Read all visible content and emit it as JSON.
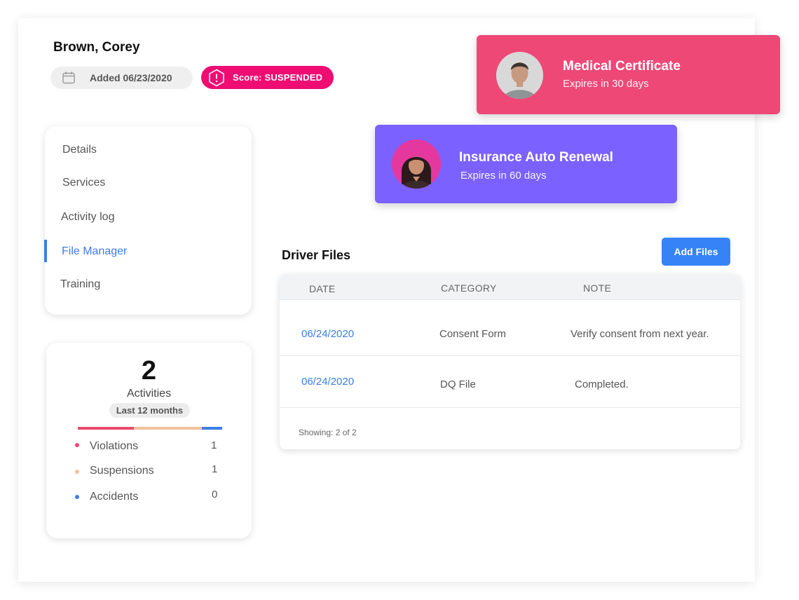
{
  "driver": {
    "name": "Brown, Corey",
    "added": "Added 06/23/2020",
    "score": "Score: SUSPENDED"
  },
  "nav": {
    "items": [
      {
        "label": "Details"
      },
      {
        "label": "Services"
      },
      {
        "label": "Activity log"
      },
      {
        "label": "File Manager"
      },
      {
        "label": "Training"
      }
    ],
    "active": "File Manager"
  },
  "activities": {
    "count": "2",
    "label": "Activities",
    "period": "Last 12 months",
    "rows": [
      {
        "label": "Violations",
        "value": "1",
        "color": "#e94a6f"
      },
      {
        "label": "Suspensions",
        "value": "1",
        "color": "#f1c39c"
      },
      {
        "label": "Accidents",
        "value": "0",
        "color": "#3b7de8"
      }
    ]
  },
  "alerts": [
    {
      "title": "Medical Certificate",
      "subtitle": "Expires in 30 days",
      "color": "#ee4877"
    },
    {
      "title": "Insurance Auto Renewal",
      "subtitle": "Expires in 60 days",
      "color": "#7b61ff"
    }
  ],
  "files": {
    "title": "Driver Files",
    "add_label": "Add Files",
    "columns": [
      "DATE",
      "CATEGORY",
      "NOTE"
    ],
    "rows": [
      {
        "date": "06/24/2020",
        "category": "Consent Form",
        "note": "Verify consent from next year."
      },
      {
        "date": "06/24/2020",
        "category": "DQ File",
        "note": "Completed."
      }
    ],
    "footer": "Showing: 2 of 2"
  },
  "colors": {
    "accent": "#3b7de8",
    "suspended": "#ef0c73"
  }
}
